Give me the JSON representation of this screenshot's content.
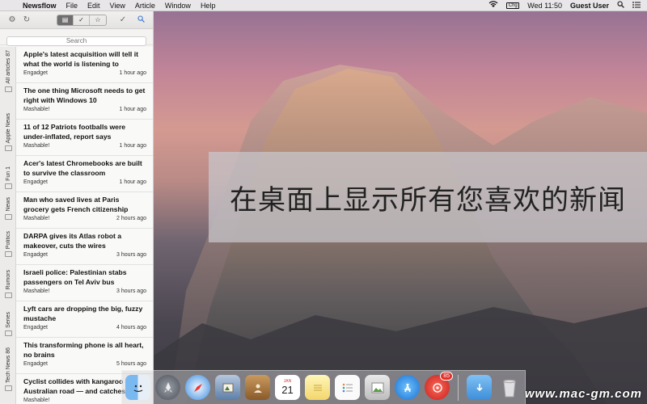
{
  "menubar": {
    "app_name": "Newsflow",
    "menus": [
      "File",
      "Edit",
      "View",
      "Article",
      "Window",
      "Help"
    ],
    "battery": "Chg",
    "clock": "Wed 11:50",
    "user": "Guest User"
  },
  "toolbar": {
    "search_placeholder": "Search"
  },
  "categories": [
    "All articles 87",
    "Apple News",
    "Fun 1",
    "News",
    "Politics",
    "Rumors",
    "Series",
    "Tech News 86"
  ],
  "articles": [
    {
      "title": "Apple's latest acquisition will tell it what the world is listening to",
      "source": "Engadget",
      "time": "1 hour ago"
    },
    {
      "title": "The one thing Microsoft needs to get right with Windows 10",
      "source": "Mashable!",
      "time": "1 hour ago"
    },
    {
      "title": "11 of 12 Patriots footballs were under-inflated, report says",
      "source": "Mashable!",
      "time": "1 hour ago"
    },
    {
      "title": "Acer's latest Chromebooks are built to survive the classroom",
      "source": "Engadget",
      "time": "1 hour ago"
    },
    {
      "title": "Man who saved lives at Paris grocery gets French citizenship",
      "source": "Mashable!",
      "time": "2 hours ago"
    },
    {
      "title": "DARPA gives its Atlas robot a makeover, cuts the wires",
      "source": "Engadget",
      "time": "3 hours ago"
    },
    {
      "title": "Israeli police: Palestinian stabs passengers on Tel Aviv bus",
      "source": "Mashable!",
      "time": "3 hours ago"
    },
    {
      "title": "Lyft cars are dropping the big, fuzzy mustache",
      "source": "Engadget",
      "time": "4 hours ago"
    },
    {
      "title": "This transforming phone is all heart, no brains",
      "source": "Engadget",
      "time": "5 hours ago"
    },
    {
      "title": "Cyclist collides with kangaroo on Australian road — and catches",
      "source": "Mashable!",
      "time": ""
    }
  ],
  "banner": {
    "text": "在桌面上显示所有您喜欢的新闻"
  },
  "dock": {
    "calendar_month": "JAN",
    "calendar_day": "21",
    "badge_count": "85"
  },
  "watermark": "www.mac-gm.com"
}
